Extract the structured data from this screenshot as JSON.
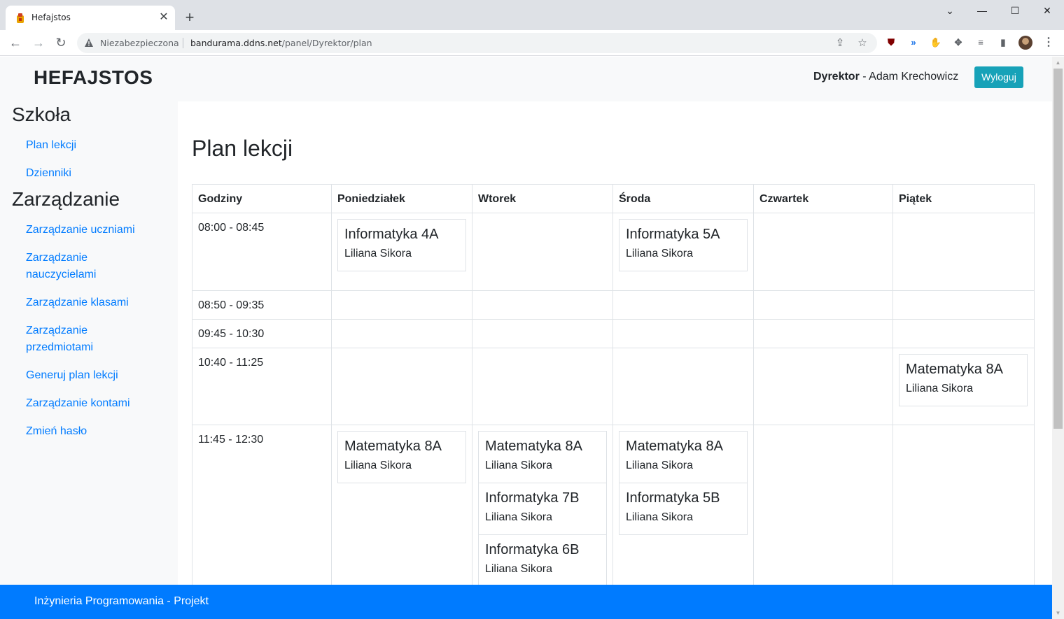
{
  "browser": {
    "tab_title": "Hefajstos",
    "not_secure": "Niezabezpieczona",
    "url_host": "bandurama.ddns.net",
    "url_path": "/panel/Dyrektor/plan"
  },
  "header": {
    "brand": "HEFAJSTOS",
    "role": "Dyrektor",
    "user_separator": " - ",
    "user_name": "Adam Krechowicz",
    "logout_label": "Wyloguj"
  },
  "sidebar": {
    "school_heading": "Szkoła",
    "school_items": [
      "Plan lekcji",
      "Dzienniki"
    ],
    "manage_heading": "Zarządzanie",
    "manage_items": [
      "Zarządzanie uczniami",
      "Zarządzanie nauczycielami",
      "Zarządzanie klasami",
      "Zarządzanie przedmiotami",
      "Generuj plan lekcji",
      "Zarządzanie kontami",
      "Zmień hasło"
    ]
  },
  "main": {
    "title": "Plan lekcji",
    "columns": [
      "Godziny",
      "Poniedziałek",
      "Wtorek",
      "Środa",
      "Czwartek",
      "Piątek"
    ],
    "rows": [
      {
        "time": "08:00 - 08:45",
        "cells": [
          [
            {
              "subject": "Informatyka 4A",
              "teacher": "Liliana Sikora"
            }
          ],
          [],
          [
            {
              "subject": "Informatyka 5A",
              "teacher": "Liliana Sikora"
            }
          ],
          [],
          []
        ]
      },
      {
        "time": "08:50 - 09:35",
        "cells": [
          [],
          [],
          [],
          [],
          []
        ]
      },
      {
        "time": "09:45 - 10:30",
        "cells": [
          [],
          [],
          [],
          [],
          []
        ]
      },
      {
        "time": "10:40 - 11:25",
        "cells": [
          [],
          [],
          [],
          [],
          [
            {
              "subject": "Matematyka 8A",
              "teacher": "Liliana Sikora"
            }
          ]
        ]
      },
      {
        "time": "11:45 - 12:30",
        "cells": [
          [
            {
              "subject": "Matematyka 8A",
              "teacher": "Liliana Sikora"
            }
          ],
          [
            {
              "subject": "Matematyka 8A",
              "teacher": "Liliana Sikora"
            },
            {
              "subject": "Informatyka 7B",
              "teacher": "Liliana Sikora"
            },
            {
              "subject": "Informatyka 6B",
              "teacher": "Liliana Sikora"
            }
          ],
          [
            {
              "subject": "Matematyka 8A",
              "teacher": "Liliana Sikora"
            },
            {
              "subject": "Informatyka 5B",
              "teacher": "Liliana Sikora"
            }
          ],
          [],
          []
        ]
      }
    ]
  },
  "footer": {
    "text": "Inżynieria Programowania - Projekt"
  }
}
